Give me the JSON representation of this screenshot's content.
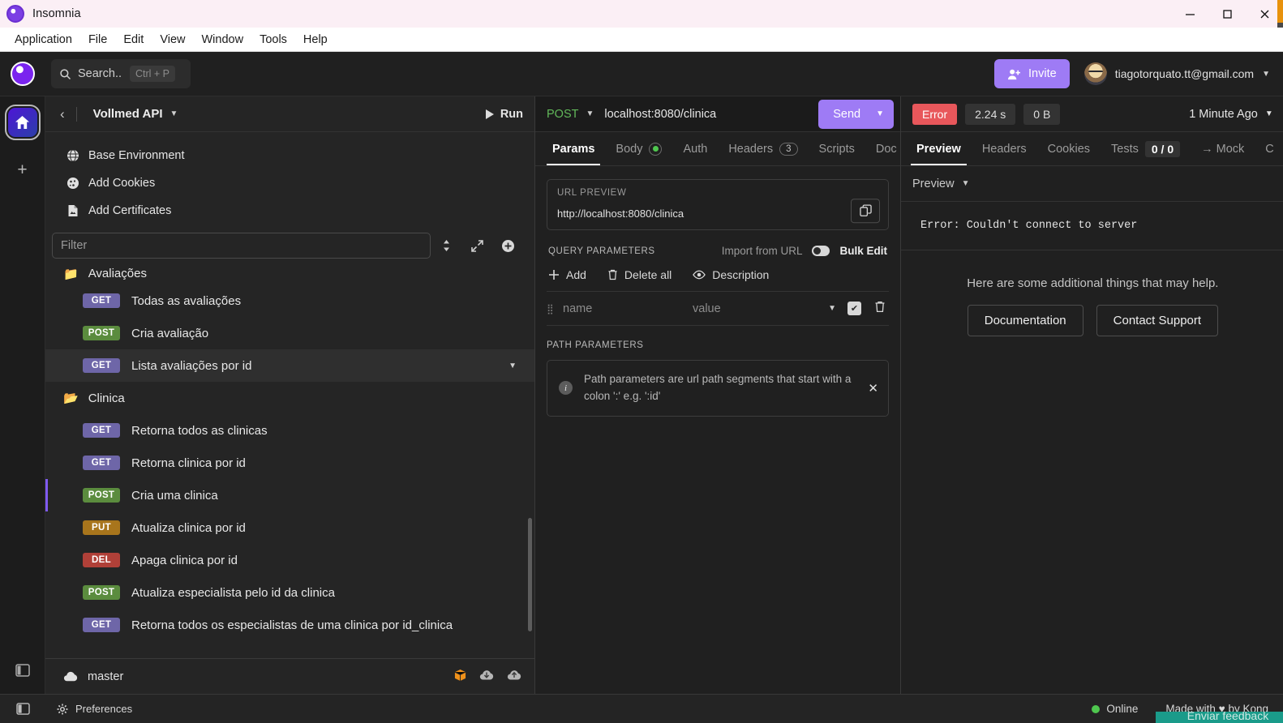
{
  "window": {
    "title": "Insomnia",
    "minimize": "minimize-icon",
    "maximize": "maximize-icon",
    "close": "close-icon"
  },
  "menubar": {
    "items": [
      {
        "label": "Application"
      },
      {
        "label": "File"
      },
      {
        "label": "Edit"
      },
      {
        "label": "View"
      },
      {
        "label": "Window"
      },
      {
        "label": "Tools"
      },
      {
        "label": "Help"
      }
    ]
  },
  "appheader": {
    "search": {
      "label": "Search..",
      "shortcut": "Ctrl + P"
    },
    "invite_label": "Invite",
    "account_email": "tiagotorquato.tt@gmail.com"
  },
  "sidebar": {
    "collection_title": "Vollmed API",
    "run_label": "Run",
    "environment_items": [
      {
        "label": "Base Environment",
        "icon": "globe-icon"
      },
      {
        "label": "Add Cookies",
        "icon": "cookie-icon"
      },
      {
        "label": "Add Certificates",
        "icon": "certificate-icon"
      }
    ],
    "filter_placeholder": "Filter",
    "requests": [
      {
        "method": "",
        "label": "Avaliações",
        "type": "folder",
        "clipped": true
      },
      {
        "method": "GET",
        "label": "Todas as avaliações",
        "type": "request"
      },
      {
        "method": "POST",
        "label": "Cria avaliação",
        "type": "request"
      },
      {
        "method": "GET",
        "label": "Lista avaliações por id",
        "type": "request",
        "selected": true,
        "chevron": true
      },
      {
        "method": "",
        "label": "Clinica",
        "type": "folder"
      },
      {
        "method": "GET",
        "label": "Retorna todos as clinicas",
        "type": "request"
      },
      {
        "method": "GET",
        "label": "Retorna clinica por id",
        "type": "request"
      },
      {
        "method": "POST",
        "label": "Cria uma clinica",
        "type": "request",
        "active": true
      },
      {
        "method": "PUT",
        "label": "Atualiza clinica por id",
        "type": "request"
      },
      {
        "method": "DEL",
        "label": "Apaga clinica por id",
        "type": "request"
      },
      {
        "method": "POST",
        "label": "Atualiza especialista pelo id da clinica",
        "type": "request"
      },
      {
        "method": "GET",
        "label": "Retorna todos os especialistas de uma clinica por id_clinica",
        "type": "request"
      }
    ],
    "branch": "master",
    "branch_icons": [
      "package-icon",
      "cloud-download-icon",
      "cloud-upload-icon"
    ]
  },
  "request": {
    "method": "POST",
    "url": "localhost:8080/clinica",
    "send_label": "Send",
    "tabs": [
      {
        "label": "Params",
        "active": true
      },
      {
        "label": "Body",
        "badge": "dot"
      },
      {
        "label": "Auth"
      },
      {
        "label": "Headers",
        "badge": "3"
      },
      {
        "label": "Scripts"
      },
      {
        "label": "Doc"
      }
    ],
    "url_preview": {
      "label": "URL PREVIEW",
      "value": "http://localhost:8080/clinica",
      "copy_icon": "copy-icon"
    },
    "query_parameters": {
      "title": "QUERY PARAMETERS",
      "import_label": "Import from URL",
      "bulk_edit_label": "Bulk Edit",
      "tools": [
        {
          "label": "Add",
          "icon": "plus-icon"
        },
        {
          "label": "Delete all",
          "icon": "trash-icon"
        },
        {
          "label": "Description",
          "icon": "eye-icon"
        }
      ],
      "row": {
        "name_placeholder": "name",
        "value_placeholder": "value"
      }
    },
    "path_parameters": {
      "title": "PATH PARAMETERS",
      "info": "Path parameters are url path segments that start with a colon ':' e.g. ':id'"
    }
  },
  "response": {
    "status": "Error",
    "time": "2.24 s",
    "size": "0 B",
    "timestamp": "1 Minute Ago",
    "tabs": [
      {
        "label": "Preview",
        "active": true
      },
      {
        "label": "Headers"
      },
      {
        "label": "Cookies"
      },
      {
        "label": "Tests",
        "badge": "0 / 0"
      },
      {
        "label": "→ Mock"
      },
      {
        "label": "C"
      }
    ],
    "preview_mode": "Preview",
    "error_text": "Error: Couldn't connect to server",
    "help_text": "Here are some additional things that may help.",
    "help_buttons": [
      {
        "label": "Documentation"
      },
      {
        "label": "Contact Support"
      }
    ]
  },
  "statusbar": {
    "preferences_label": "Preferences",
    "online_label": "Online",
    "made_with": "Made with ♥ by Kong",
    "peek_text": "Enviar feedback"
  },
  "colors": {
    "accent": "#9e7bf5",
    "error": "#e8575b",
    "online": "#4fc74f",
    "get": "#6e66a8",
    "post": "#5b8c3e",
    "put": "#a8751c",
    "del": "#b04038"
  }
}
